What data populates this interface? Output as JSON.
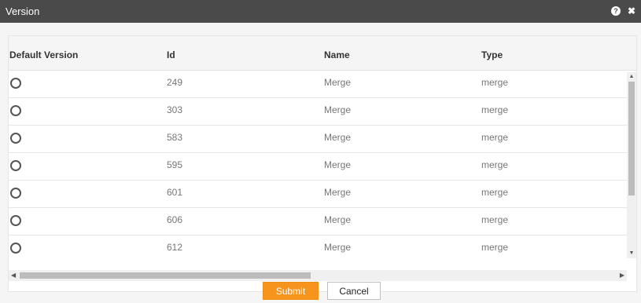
{
  "dialog": {
    "title": "Version",
    "help_icon": "help-icon",
    "help_glyph": "?",
    "close_icon": "close-icon",
    "close_glyph": "✖"
  },
  "table": {
    "columns": [
      "Default Version",
      "Id",
      "Name",
      "Type"
    ],
    "rows": [
      {
        "id": "249",
        "name": "Merge",
        "type": "merge"
      },
      {
        "id": "303",
        "name": "Merge",
        "type": "merge"
      },
      {
        "id": "583",
        "name": "Merge",
        "type": "merge"
      },
      {
        "id": "595",
        "name": "Merge",
        "type": "merge"
      },
      {
        "id": "601",
        "name": "Merge",
        "type": "merge"
      },
      {
        "id": "606",
        "name": "Merge",
        "type": "merge"
      },
      {
        "id": "612",
        "name": "Merge",
        "type": "merge"
      }
    ]
  },
  "scroll": {
    "up_glyph": "▲",
    "down_glyph": "▼",
    "left_glyph": "◀",
    "right_glyph": "▶"
  },
  "actions": {
    "submit_label": "Submit",
    "cancel_label": "Cancel"
  }
}
